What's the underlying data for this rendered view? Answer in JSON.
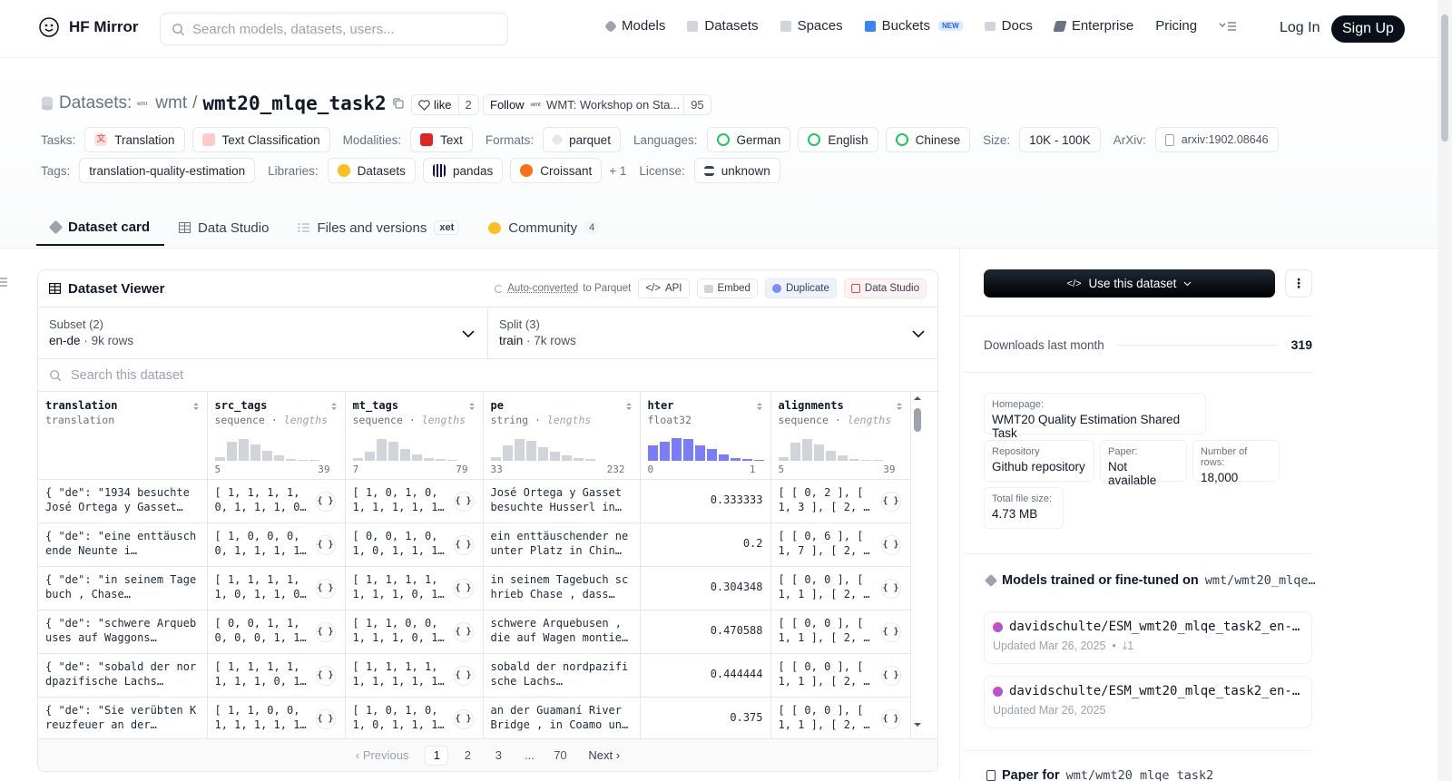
{
  "nav": {
    "brand": "HF Mirror",
    "search_placeholder": "Search models, datasets, users...",
    "links": [
      "Models",
      "Datasets",
      "Spaces",
      "Buckets",
      "Docs",
      "Enterprise",
      "Pricing"
    ],
    "new_badge": "NEW",
    "login": "Log In",
    "signup": "Sign Up"
  },
  "repo": {
    "kind": "Datasets:",
    "owner": "wmt",
    "slash": "/",
    "name": "wmt20_mlqe_task2",
    "like_label": "like",
    "like_count": "2",
    "follow_label": "Follow",
    "follow_org": "WMT: Workshop on Sta...",
    "follow_count": "95"
  },
  "meta_row1": {
    "tasks_label": "Tasks:",
    "tasks": [
      "Translation",
      "Text Classification"
    ],
    "modalities_label": "Modalities:",
    "modalities": [
      "Text"
    ],
    "formats_label": "Formats:",
    "formats": [
      "parquet"
    ],
    "languages_label": "Languages:",
    "languages": [
      "German",
      "English",
      "Chinese"
    ],
    "size_label": "Size:",
    "size": "10K - 100K",
    "arxiv_label": "ArXiv:",
    "arxiv": "arxiv:1902.08646"
  },
  "meta_row2": {
    "tags_label": "Tags:",
    "tags": [
      "translation-quality-estimation"
    ],
    "libraries_label": "Libraries:",
    "libraries": [
      "Datasets",
      "pandas",
      "Croissant"
    ],
    "more": "+ 1",
    "license_label": "License:",
    "license": "unknown"
  },
  "tabs": {
    "dataset_card": "Dataset card",
    "data_studio": "Data Studio",
    "files": "Files and versions",
    "xet": "xet",
    "community": "Community",
    "community_count": "4"
  },
  "viewer": {
    "title": "Dataset Viewer",
    "auto_converted": "Auto-converted",
    "to_parquet": "to Parquet",
    "api": "API",
    "embed": "Embed",
    "duplicate": "Duplicate",
    "data_studio": "Data Studio",
    "subset_label": "Subset (2)",
    "subset_value": "en-de",
    "subset_rows": "9k rows",
    "split_label": "Split (3)",
    "split_value": "train",
    "split_rows": "7k rows",
    "search_placeholder": "Search this dataset",
    "columns": [
      {
        "name": "translation",
        "type": "translation",
        "hint": "",
        "min": "",
        "max": ""
      },
      {
        "name": "src_tags",
        "type": "sequence",
        "hint": "lengths",
        "min": "5",
        "max": "39"
      },
      {
        "name": "mt_tags",
        "type": "sequence",
        "hint": "lengths",
        "min": "7",
        "max": "79"
      },
      {
        "name": "pe",
        "type": "string",
        "hint": "lengths",
        "min": "33",
        "max": "232"
      },
      {
        "name": "hter",
        "type": "float32",
        "hint": "",
        "min": "0",
        "max": "1"
      },
      {
        "name": "alignments",
        "type": "sequence",
        "hint": "lengths",
        "min": "5",
        "max": "39"
      }
    ],
    "histograms": {
      "src_tags": [
        0.15,
        0.75,
        0.85,
        0.65,
        0.4,
        0.2,
        0.08,
        0.05,
        0.04
      ],
      "mt_tags": [
        0.1,
        0.35,
        0.85,
        0.75,
        0.45,
        0.25,
        0.12,
        0.06,
        0.05
      ],
      "pe": [
        0.15,
        0.6,
        0.85,
        0.8,
        0.55,
        0.35,
        0.2,
        0.1,
        0.06
      ],
      "hter": [
        0.6,
        0.75,
        0.9,
        0.85,
        0.6,
        0.45,
        0.25,
        0.1,
        0.06,
        0.05
      ],
      "alignments": [
        0.15,
        0.7,
        0.85,
        0.65,
        0.4,
        0.2,
        0.08,
        0.05,
        0.04
      ]
    },
    "json_btn": "{ }",
    "rows": [
      [
        "{ \"de\": \"1934 besuchte José Ortega y Gasset…",
        "[ 1, 1, 1, 1, 0, 1, 1, 1, 0…",
        "[ 1, 0, 1, 0, 1, 1, 1, 1, 1…",
        "José Ortega y Gasset besuchte Husserl in…",
        "0.333333",
        "[ [ 0, 2 ], [ 1, 3 ], [ 2, …"
      ],
      [
        "{ \"de\": \"eine enttäuschende Neunte i…",
        "[ 1, 0, 0, 0, 0, 1, 1, 1, 1…",
        "[ 0, 0, 1, 0, 1, 0, 1, 1, 1…",
        "ein enttäuschender neunter Platz in Chin…",
        "0.2",
        "[ [ 0, 6 ], [ 1, 7 ], [ 2, …"
      ],
      [
        "{ \"de\": \"in seinem Tagebuch , Chase…",
        "[ 1, 1, 1, 1, 1, 0, 1, 1, 0…",
        "[ 1, 1, 1, 1, 1, 1, 1, 0, 1…",
        "in seinem Tagebuch schrieb Chase , dass…",
        "0.304348",
        "[ [ 0, 0 ], [ 1, 1 ], [ 2, …"
      ],
      [
        "{ \"de\": \"schwere Arquebuses auf Waggons…",
        "[ 0, 0, 1, 1, 0, 0, 0, 1, 1…",
        "[ 1, 1, 0, 0, 1, 1, 1, 0, 1…",
        "schwere Arquebusen , die auf Wagen montier…",
        "0.470588",
        "[ [ 0, 0 ], [ 1, 1 ], [ 2, …"
      ],
      [
        "{ \"de\": \"sobald der nordpazifische Lachs…",
        "[ 1, 1, 1, 1, 1, 1, 1, 0, 1…",
        "[ 1, 1, 1, 1, 1, 1, 1, 1, 1…",
        "sobald der nordpazifische Lachs…",
        "0.444444",
        "[ [ 0, 0 ], [ 1, 1 ], [ 2, …"
      ],
      [
        "{ \"de\": \"Sie verübten Kreuzfeuer an der…",
        "[ 1, 1, 0, 0, 1, 1, 1, 1, 1…",
        "[ 1, 0, 1, 0, 1, 0, 1, 1, 1…",
        "an der Guamaní River Bridge , in Coamo und…",
        "0.375",
        "[ [ 0, 0 ], [ 1, 1 ], [ 2, …"
      ]
    ],
    "pager": {
      "prev": "Previous",
      "pages": [
        "1",
        "2",
        "3",
        "...",
        "70"
      ],
      "next": "Next"
    }
  },
  "side": {
    "use_dataset": "Use this dataset",
    "downloads_label": "Downloads last month",
    "downloads_value": "319",
    "homepage_label": "Homepage:",
    "homepage_value": "WMT20 Quality Estimation Shared Task",
    "repository_label": "Repository",
    "repository_value": "Github repository",
    "paper_label": "Paper:",
    "paper_value": "Not available",
    "nrows_label": "Number of rows:",
    "nrows_value": "18,000",
    "filesize_label": "Total file size:",
    "filesize_value": "4.73 MB",
    "models_heading": "Models trained or fine-tuned on",
    "models_repo": "wmt/wmt20_mlqe…",
    "models": [
      {
        "name": "davidschulte/ESM_wmt20_mlqe_task2_en-…",
        "updated": "Updated Mar 26, 2025",
        "downloads": "1"
      },
      {
        "name": "davidschulte/ESM_wmt20_mlqe_task2_en-…",
        "updated": "Updated Mar 26, 2025",
        "downloads": ""
      }
    ],
    "paper_heading": "Paper for",
    "paper_repo": "wmt/wmt20_mlqe_task2"
  },
  "colors": {
    "accent": "#6366f1",
    "brand_dark": "#0b0f19",
    "border": "#e5e7eb"
  }
}
